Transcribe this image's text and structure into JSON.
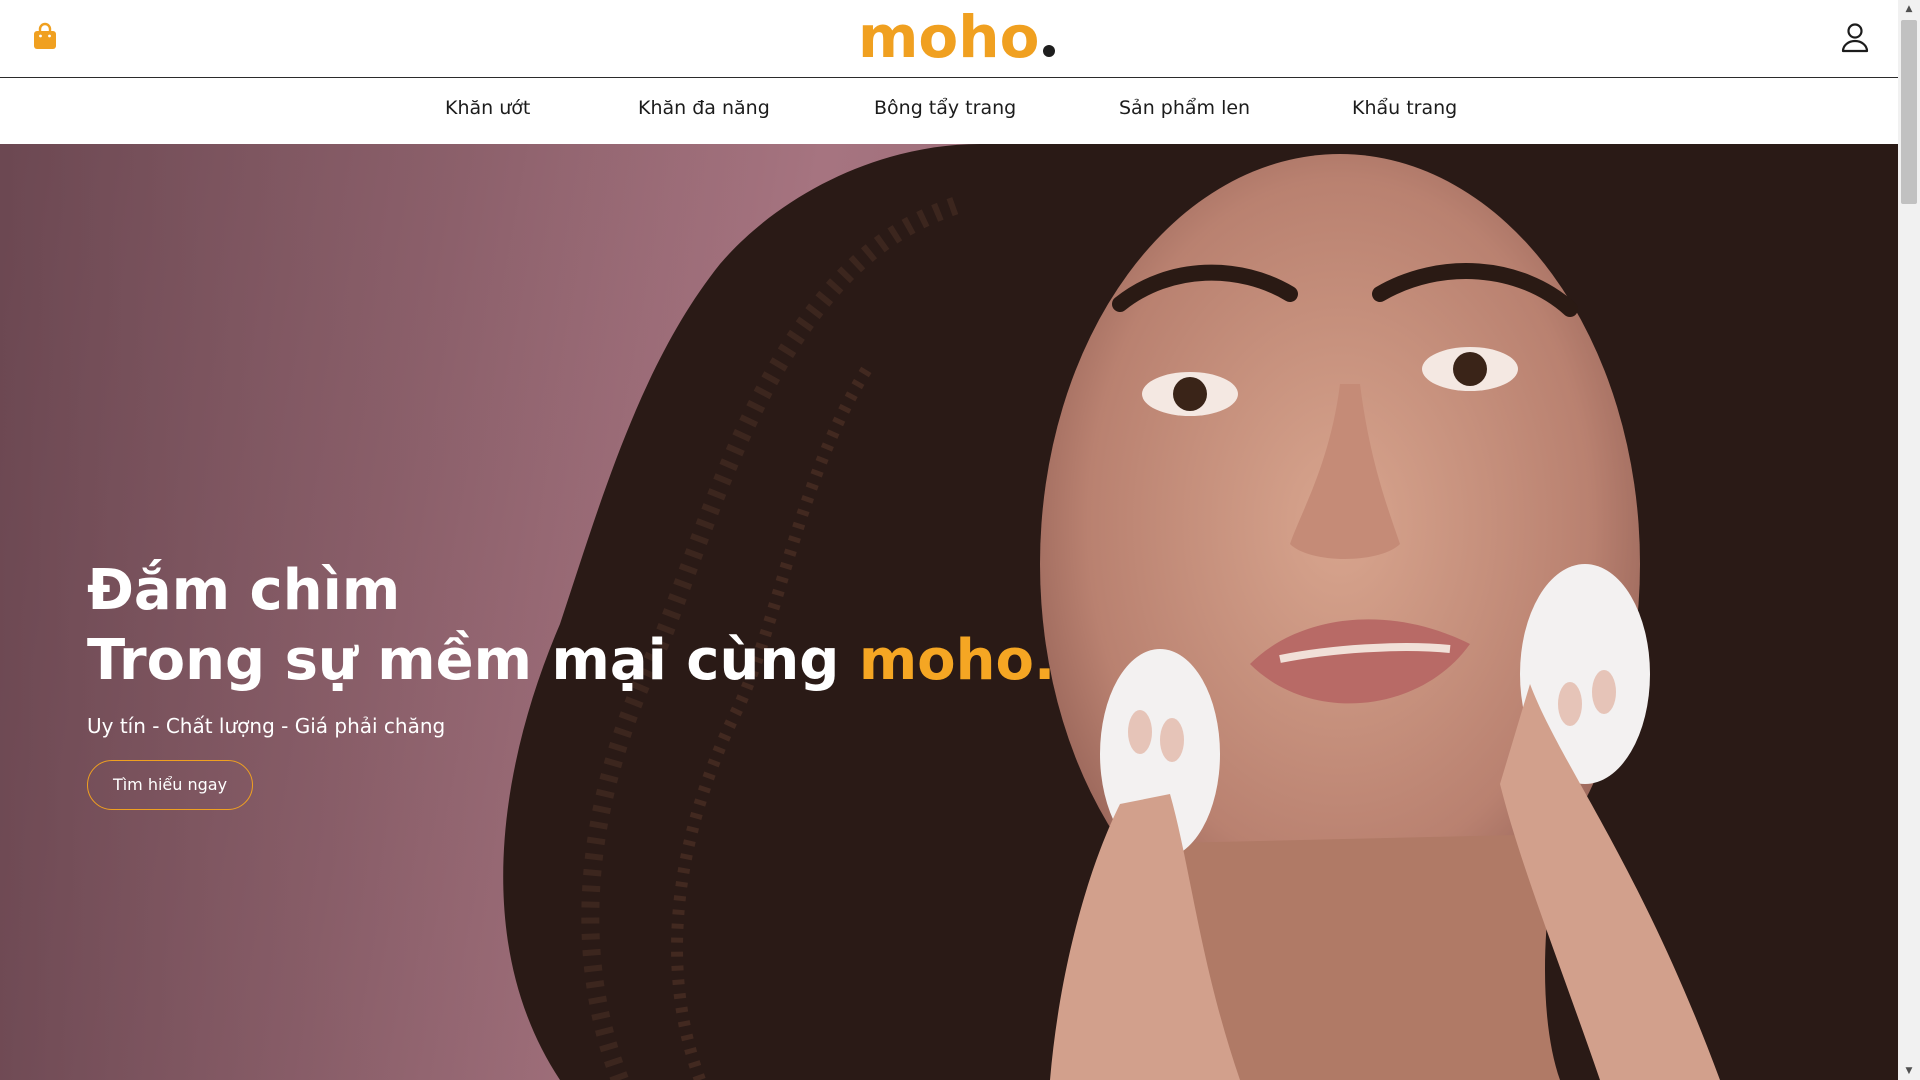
{
  "header": {
    "logo_text": "moho",
    "logo_dot": ".",
    "brand_color": "#f0a020",
    "cart_icon": "shopping-bag-icon",
    "user_icon": "user-icon"
  },
  "nav": {
    "items": [
      {
        "label": "Khăn ướt"
      },
      {
        "label": "Khăn đa năng"
      },
      {
        "label": "Bông tẩy trang"
      },
      {
        "label": "Sản phẩm len"
      },
      {
        "label": "Khẩu trang"
      }
    ]
  },
  "hero": {
    "title_line1": "Đắm chìm",
    "title_line2_prefix": "Trong sự mềm mại cùng ",
    "title_line2_brand": "moho.",
    "subtitle": "Uy tín - Chất lượng - Giá phải chăng",
    "cta_label": "Tìm hiểu ngay",
    "accent_color": "#f5a623",
    "background_color": "#8a5e69"
  }
}
